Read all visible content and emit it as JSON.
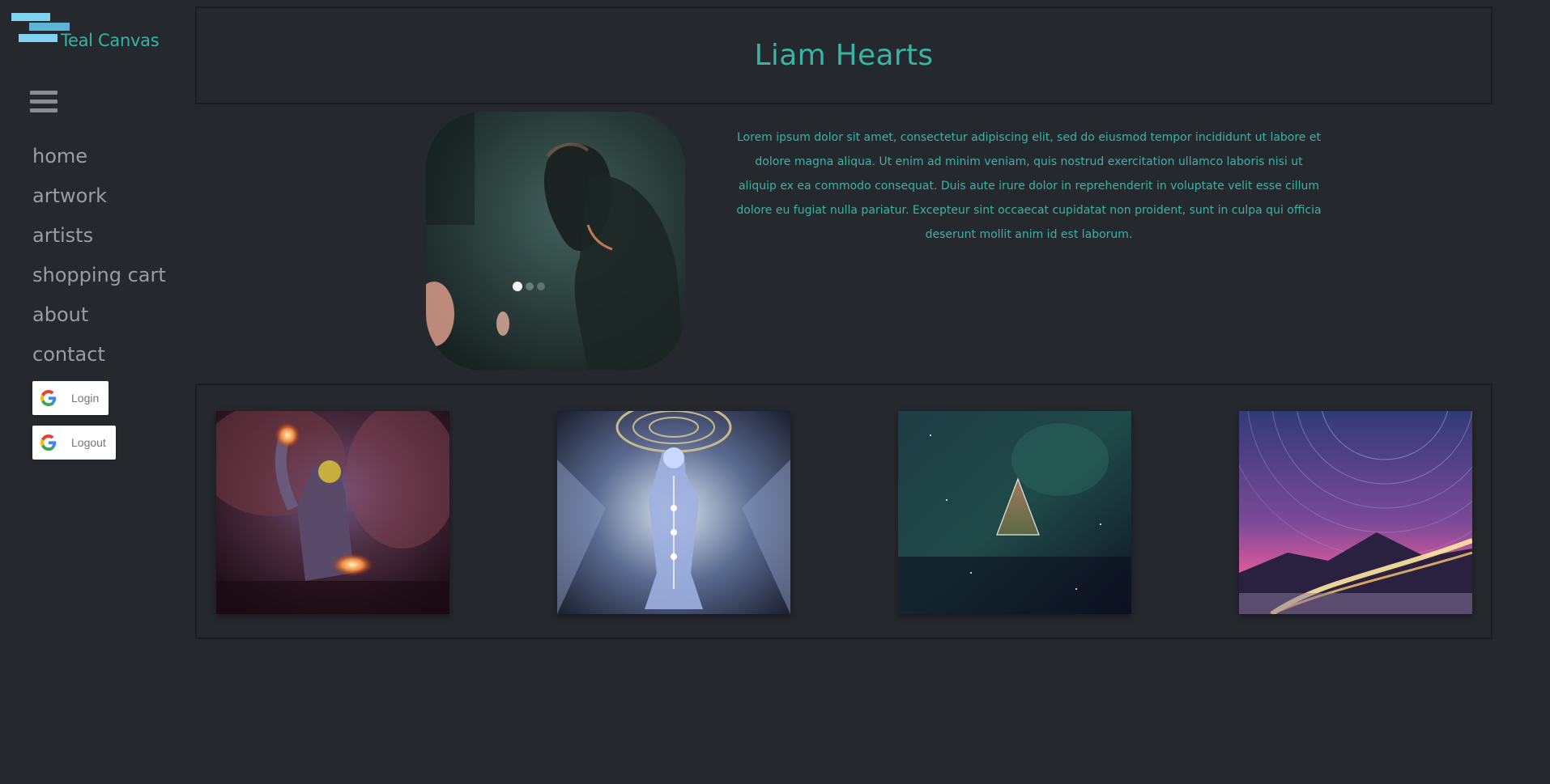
{
  "brand": {
    "name": "Teal Canvas",
    "logo_color": "#7fd3f0",
    "accent_color": "#3ab3a4"
  },
  "menu_icon": "hamburger-icon",
  "nav": {
    "items": [
      "home",
      "artwork",
      "artists",
      "shopping cart",
      "about",
      "contact"
    ]
  },
  "auth": {
    "login_label": "Login",
    "logout_label": "Logout",
    "provider_icon": "google-icon"
  },
  "artist": {
    "name": "Liam Hearts",
    "bio": "Lorem ipsum dolor sit amet, consectetur adipiscing elit, sed do eiusmod tempor incididunt ut labore et dolore magna aliqua. Ut enim ad minim veniam, quis nostrud exercitation ullamco laboris nisi ut aliquip ex ea commodo consequat. Duis aute irure dolor in reprehenderit in voluptate velit esse cillum dolore eu fugiat nulla pariatur. Excepteur sint occaecat cupidatat non proident, sunt in culpa qui officia deserunt mollit anim id est laborum."
  },
  "gallery": {
    "count": 4
  },
  "colors": {
    "background": "#25282d",
    "nav_text": "#9a9da2",
    "border": "#1b1d21"
  }
}
